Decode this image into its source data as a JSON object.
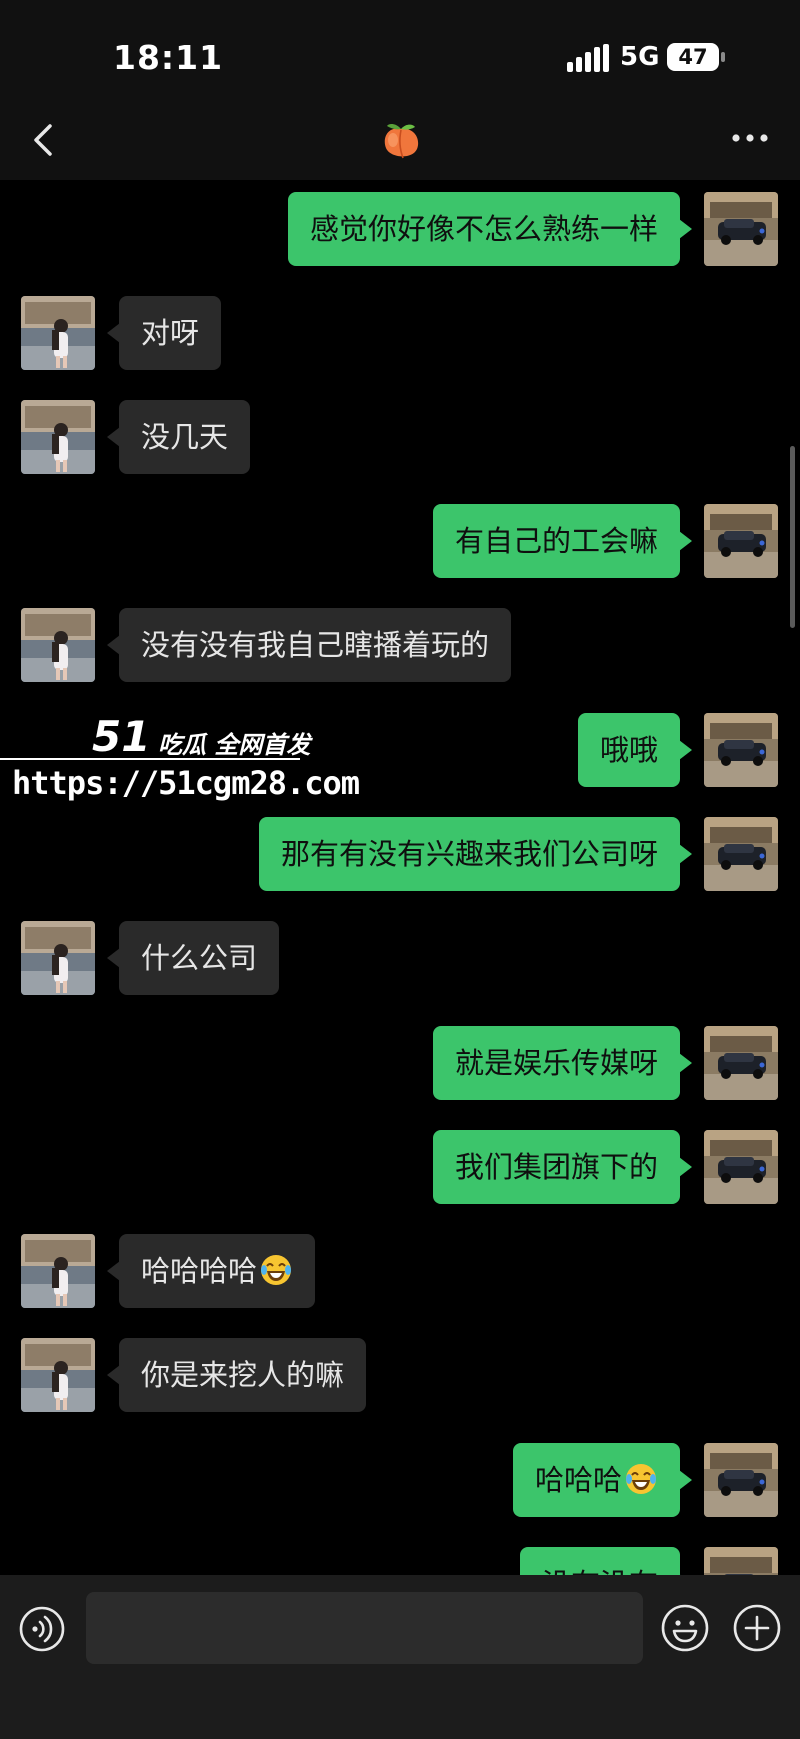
{
  "status": {
    "time": "18:11",
    "network": "5G",
    "battery": "47"
  },
  "header": {
    "title_icon": "peach-emoji-icon"
  },
  "messages": [
    {
      "side": "me",
      "text": "感觉你好像不怎么熟练一样"
    },
    {
      "side": "them",
      "text": "对呀"
    },
    {
      "side": "them",
      "text": "没几天"
    },
    {
      "side": "me",
      "text": "有自己的工会嘛"
    },
    {
      "side": "them",
      "text": "没有没有我自己瞎播着玩的"
    },
    {
      "side": "me",
      "text": "哦哦"
    },
    {
      "side": "me",
      "text": "那有有没有兴趣来我们公司呀"
    },
    {
      "side": "them",
      "text": "什么公司"
    },
    {
      "side": "me",
      "text": "就是娱乐传媒呀"
    },
    {
      "side": "me",
      "text": "我们集团旗下的"
    },
    {
      "side": "them",
      "text": "哈哈哈哈",
      "emoji": "laughing-tears-emoji"
    },
    {
      "side": "them",
      "text": "你是来挖人的嘛"
    },
    {
      "side": "me",
      "text": "哈哈哈",
      "emoji": "laughing-tears-emoji"
    },
    {
      "side": "me",
      "text": "没有没有"
    }
  ],
  "watermark": {
    "brand": "51",
    "tagline": "吃瓜 全网首发",
    "url": "https://51cgm28.com"
  },
  "input": {
    "placeholder": ""
  },
  "colors": {
    "sent_bubble": "#3cc56b",
    "received_bubble": "#2a2a2a",
    "chat_background": "#000000",
    "bar_background": "#1c1c1c"
  }
}
